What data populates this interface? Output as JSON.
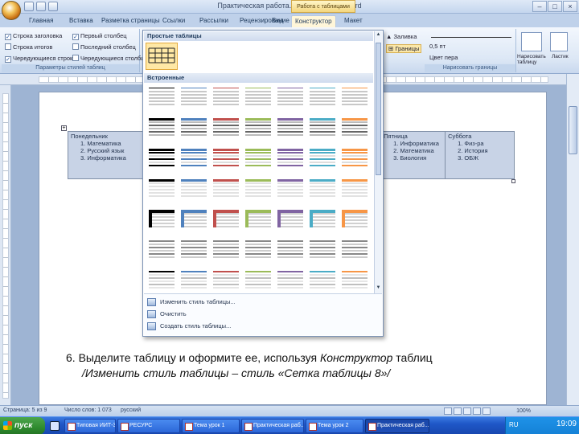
{
  "window": {
    "title": "Практическая работа.docx - Microsoft Word",
    "context_tab_title": "Работа с таблицами",
    "controls": [
      "–",
      "□",
      "×"
    ]
  },
  "tabs": [
    {
      "label": "Главная"
    },
    {
      "label": "Вставка"
    },
    {
      "label": "Разметка страницы"
    },
    {
      "label": "Ссылки"
    },
    {
      "label": "Рассылки"
    },
    {
      "label": "Рецензирование"
    },
    {
      "label": "Вид"
    },
    {
      "label": "Конструктор",
      "active": true
    },
    {
      "label": "Макет"
    }
  ],
  "ribbon": {
    "style_options_group": {
      "label": "Параметры стилей таблиц",
      "checkboxes": [
        {
          "label": "Строка заголовка",
          "checked": true
        },
        {
          "label": "Первый столбец",
          "checked": true
        },
        {
          "label": "Строка итогов",
          "checked": false
        },
        {
          "label": "Последний столбец",
          "checked": false
        },
        {
          "label": "Чередующиеся строки",
          "checked": true
        },
        {
          "label": "Чередующиеся столбцы",
          "checked": false
        }
      ]
    },
    "shading_label": "Заливка",
    "borders_label": "Границы",
    "pen_weight": "0,5 пт",
    "pen_color": "Цвет пера",
    "draw_group_label": "Нарисовать границы",
    "draw_table_label": "Нарисовать таблицу",
    "eraser_label": "Ластик"
  },
  "gallery": {
    "section_plain": "Простые таблицы",
    "section_builtin": "Встроенные",
    "footer_items": [
      {
        "label": "Изменить стиль таблицы...",
        "icon": "modify-style-icon"
      },
      {
        "label": "Очистить",
        "icon": "clear-icon"
      },
      {
        "label": "Создать стиль таблицы...",
        "icon": "new-style-icon"
      }
    ],
    "row_palettes": [
      [
        "#000000",
        "#4f81bd",
        "#c0504d",
        "#9bbb59",
        "#8064a2",
        "#4bacc6",
        "#f79646"
      ],
      [
        "#000000",
        "#4f81bd",
        "#c0504d",
        "#9bbb59",
        "#8064a2",
        "#4bacc6",
        "#f79646"
      ],
      [
        "#000000",
        "#4f81bd",
        "#c0504d",
        "#9bbb59",
        "#8064a2",
        "#4bacc6",
        "#f79646"
      ],
      [
        "#000000",
        "#4f81bd",
        "#c0504d",
        "#9bbb59",
        "#8064a2",
        "#4bacc6",
        "#f79646"
      ],
      [
        "#000000",
        "#4f81bd",
        "#c0504d",
        "#9bbb59",
        "#8064a2",
        "#4bacc6",
        "#f79646"
      ],
      [
        "#000000",
        "#4f81bd",
        "#c0504d",
        "#9bbb59",
        "#8064a2",
        "#4bacc6",
        "#f79646"
      ],
      [
        "#000000",
        "#4f81bd",
        "#c0504d",
        "#9bbb59",
        "#8064a2",
        "#4bacc6",
        "#f79646"
      ]
    ]
  },
  "doc_table": {
    "left": {
      "head": "Понедельник",
      "items": [
        "1. Математика",
        "2. Русский язык",
        "3. Информатика"
      ]
    },
    "middle": {
      "head": "Пятница",
      "items": [
        "1. Информатика",
        "2. Математика",
        "3. Биология"
      ]
    },
    "right": {
      "head": "Суббота",
      "items": [
        "1. Физ-ра",
        "2. История",
        "3. ОБЖ"
      ]
    }
  },
  "instruction": {
    "line1_prefix": "6. Выделите таблицу и оформите ее, используя ",
    "line1_italic": "Конструктор",
    "line1_suffix": " таблиц",
    "line2": "/Изменить стиль таблицы – стиль «Сетка таблицы 8»/"
  },
  "statusbar": {
    "page": "Страница: 5 из 9",
    "words": "Число слов: 1 073",
    "language": "русский",
    "zoom": "100%"
  },
  "taskbar": {
    "start": "пуск",
    "tasks": [
      {
        "label": "Типовая ИИТ-3 (ок...",
        "active": false
      },
      {
        "label": "РЕСУРС",
        "active": false
      },
      {
        "label": "Тема урок 1",
        "active": false
      },
      {
        "label": "Практическая раб...",
        "active": false
      },
      {
        "label": "Тема урок 2",
        "active": false
      },
      {
        "label": "Практическая раб...",
        "active": true
      }
    ],
    "lang": "RU",
    "clock": "19:09"
  }
}
